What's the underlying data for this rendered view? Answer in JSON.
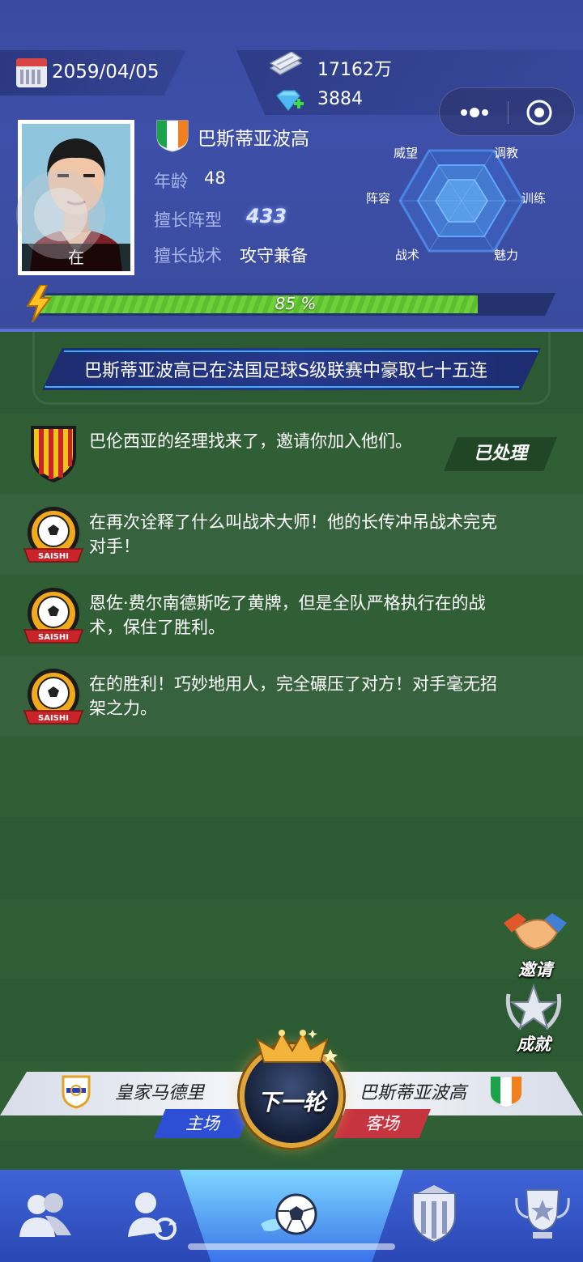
{
  "header": {
    "date": "2059/04/05",
    "cash": "17162万",
    "gems": "3884",
    "avatar_label": "在",
    "club_name": "巴斯蒂亚波高",
    "age_label": "年龄",
    "age_value": "48",
    "formation_label": "擅长阵型",
    "formation_value": "433",
    "tactic_label": "擅长战术",
    "tactic_value": "攻守兼备",
    "radar_labels": [
      "威望",
      "调教",
      "训练",
      "魅力",
      "战术",
      "阵容"
    ],
    "progress_percent": 85,
    "progress_text": "85 %"
  },
  "ticker": {
    "text": "巴斯蒂亚波高已在法国足球S级联赛中豪取七十五连"
  },
  "feed": [
    {
      "text": "巴伦西亚的经理找来了，邀请你加入他们。",
      "icon": "valencia-badge-icon",
      "action": "已处理"
    },
    {
      "text": "在再次诠释了什么叫战术大师！他的长传冲吊战术完克对手！",
      "icon": "saishi-ball-icon"
    },
    {
      "text": "恩佐·费尔南德斯吃了黄牌，但是全队严格执行在的战术，保住了胜利。",
      "icon": "saishi-ball-icon"
    },
    {
      "text": "在的胜利！巧妙地用人，完全碾压了对方！对手毫无招架之力。",
      "icon": "saishi-ball-icon"
    }
  ],
  "badge_text": "SAISHI",
  "side": {
    "invite": "邀请",
    "achievement": "成就"
  },
  "match": {
    "home_team": "皇家马德里",
    "home_tag": "主场",
    "away_team": "巴斯蒂亚波高",
    "away_tag": "客场",
    "next_label": "下一轮"
  },
  "colors": {
    "accent": "#3d4fa8",
    "progress": "#6fd13a",
    "home": "#2d4fd6",
    "away": "#c63440",
    "gold": "#e0a63a"
  }
}
